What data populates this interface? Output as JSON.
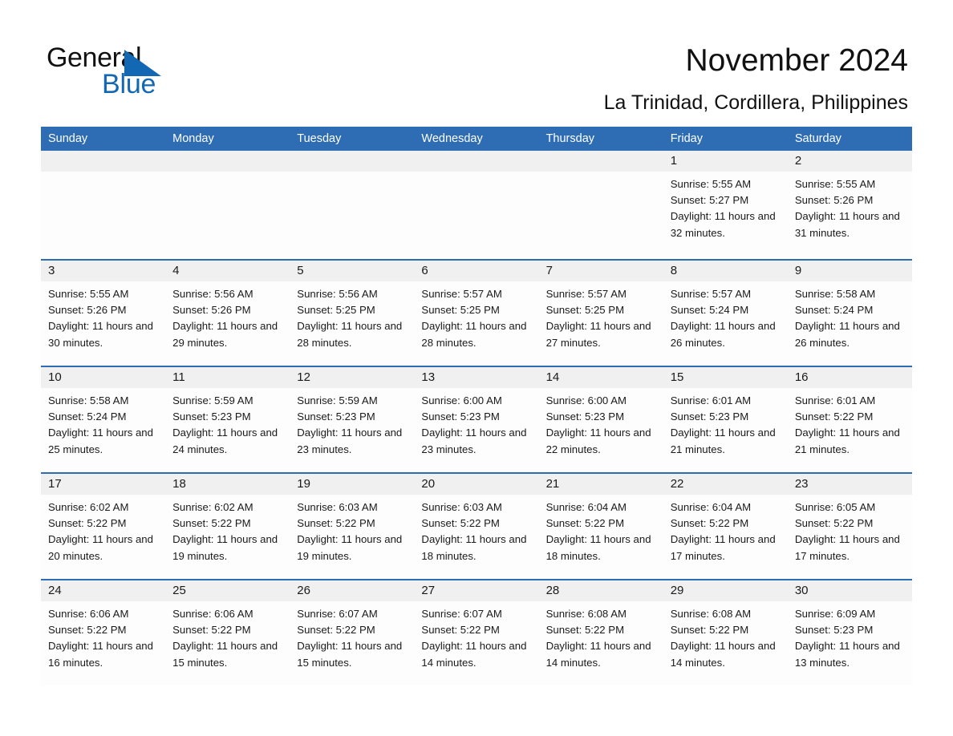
{
  "brand": {
    "name_part1": "General",
    "name_part2": "Blue",
    "logo_icon": "triangle-flag-icon",
    "accent_color": "#1268b3"
  },
  "header": {
    "title": "November 2024",
    "location": "La Trinidad, Cordillera, Philippines"
  },
  "theme": {
    "header_row_bg": "#2e6db4",
    "row_divider": "#2e6db4",
    "daynum_bg": "#f0f0f0",
    "cell_bg": "#fdfdfd"
  },
  "calendar": {
    "weekdays": [
      "Sunday",
      "Monday",
      "Tuesday",
      "Wednesday",
      "Thursday",
      "Friday",
      "Saturday"
    ],
    "weeks": [
      [
        {
          "day": "",
          "empty": true
        },
        {
          "day": "",
          "empty": true
        },
        {
          "day": "",
          "empty": true
        },
        {
          "day": "",
          "empty": true
        },
        {
          "day": "",
          "empty": true
        },
        {
          "day": "1",
          "sunrise": "Sunrise: 5:55 AM",
          "sunset": "Sunset: 5:27 PM",
          "daylight": "Daylight: 11 hours and 32 minutes."
        },
        {
          "day": "2",
          "sunrise": "Sunrise: 5:55 AM",
          "sunset": "Sunset: 5:26 PM",
          "daylight": "Daylight: 11 hours and 31 minutes."
        }
      ],
      [
        {
          "day": "3",
          "sunrise": "Sunrise: 5:55 AM",
          "sunset": "Sunset: 5:26 PM",
          "daylight": "Daylight: 11 hours and 30 minutes."
        },
        {
          "day": "4",
          "sunrise": "Sunrise: 5:56 AM",
          "sunset": "Sunset: 5:26 PM",
          "daylight": "Daylight: 11 hours and 29 minutes."
        },
        {
          "day": "5",
          "sunrise": "Sunrise: 5:56 AM",
          "sunset": "Sunset: 5:25 PM",
          "daylight": "Daylight: 11 hours and 28 minutes."
        },
        {
          "day": "6",
          "sunrise": "Sunrise: 5:57 AM",
          "sunset": "Sunset: 5:25 PM",
          "daylight": "Daylight: 11 hours and 28 minutes."
        },
        {
          "day": "7",
          "sunrise": "Sunrise: 5:57 AM",
          "sunset": "Sunset: 5:25 PM",
          "daylight": "Daylight: 11 hours and 27 minutes."
        },
        {
          "day": "8",
          "sunrise": "Sunrise: 5:57 AM",
          "sunset": "Sunset: 5:24 PM",
          "daylight": "Daylight: 11 hours and 26 minutes."
        },
        {
          "day": "9",
          "sunrise": "Sunrise: 5:58 AM",
          "sunset": "Sunset: 5:24 PM",
          "daylight": "Daylight: 11 hours and 26 minutes."
        }
      ],
      [
        {
          "day": "10",
          "sunrise": "Sunrise: 5:58 AM",
          "sunset": "Sunset: 5:24 PM",
          "daylight": "Daylight: 11 hours and 25 minutes."
        },
        {
          "day": "11",
          "sunrise": "Sunrise: 5:59 AM",
          "sunset": "Sunset: 5:23 PM",
          "daylight": "Daylight: 11 hours and 24 minutes."
        },
        {
          "day": "12",
          "sunrise": "Sunrise: 5:59 AM",
          "sunset": "Sunset: 5:23 PM",
          "daylight": "Daylight: 11 hours and 23 minutes."
        },
        {
          "day": "13",
          "sunrise": "Sunrise: 6:00 AM",
          "sunset": "Sunset: 5:23 PM",
          "daylight": "Daylight: 11 hours and 23 minutes."
        },
        {
          "day": "14",
          "sunrise": "Sunrise: 6:00 AM",
          "sunset": "Sunset: 5:23 PM",
          "daylight": "Daylight: 11 hours and 22 minutes."
        },
        {
          "day": "15",
          "sunrise": "Sunrise: 6:01 AM",
          "sunset": "Sunset: 5:23 PM",
          "daylight": "Daylight: 11 hours and 21 minutes."
        },
        {
          "day": "16",
          "sunrise": "Sunrise: 6:01 AM",
          "sunset": "Sunset: 5:22 PM",
          "daylight": "Daylight: 11 hours and 21 minutes."
        }
      ],
      [
        {
          "day": "17",
          "sunrise": "Sunrise: 6:02 AM",
          "sunset": "Sunset: 5:22 PM",
          "daylight": "Daylight: 11 hours and 20 minutes."
        },
        {
          "day": "18",
          "sunrise": "Sunrise: 6:02 AM",
          "sunset": "Sunset: 5:22 PM",
          "daylight": "Daylight: 11 hours and 19 minutes."
        },
        {
          "day": "19",
          "sunrise": "Sunrise: 6:03 AM",
          "sunset": "Sunset: 5:22 PM",
          "daylight": "Daylight: 11 hours and 19 minutes."
        },
        {
          "day": "20",
          "sunrise": "Sunrise: 6:03 AM",
          "sunset": "Sunset: 5:22 PM",
          "daylight": "Daylight: 11 hours and 18 minutes."
        },
        {
          "day": "21",
          "sunrise": "Sunrise: 6:04 AM",
          "sunset": "Sunset: 5:22 PM",
          "daylight": "Daylight: 11 hours and 18 minutes."
        },
        {
          "day": "22",
          "sunrise": "Sunrise: 6:04 AM",
          "sunset": "Sunset: 5:22 PM",
          "daylight": "Daylight: 11 hours and 17 minutes."
        },
        {
          "day": "23",
          "sunrise": "Sunrise: 6:05 AM",
          "sunset": "Sunset: 5:22 PM",
          "daylight": "Daylight: 11 hours and 17 minutes."
        }
      ],
      [
        {
          "day": "24",
          "sunrise": "Sunrise: 6:06 AM",
          "sunset": "Sunset: 5:22 PM",
          "daylight": "Daylight: 11 hours and 16 minutes."
        },
        {
          "day": "25",
          "sunrise": "Sunrise: 6:06 AM",
          "sunset": "Sunset: 5:22 PM",
          "daylight": "Daylight: 11 hours and 15 minutes."
        },
        {
          "day": "26",
          "sunrise": "Sunrise: 6:07 AM",
          "sunset": "Sunset: 5:22 PM",
          "daylight": "Daylight: 11 hours and 15 minutes."
        },
        {
          "day": "27",
          "sunrise": "Sunrise: 6:07 AM",
          "sunset": "Sunset: 5:22 PM",
          "daylight": "Daylight: 11 hours and 14 minutes."
        },
        {
          "day": "28",
          "sunrise": "Sunrise: 6:08 AM",
          "sunset": "Sunset: 5:22 PM",
          "daylight": "Daylight: 11 hours and 14 minutes."
        },
        {
          "day": "29",
          "sunrise": "Sunrise: 6:08 AM",
          "sunset": "Sunset: 5:22 PM",
          "daylight": "Daylight: 11 hours and 14 minutes."
        },
        {
          "day": "30",
          "sunrise": "Sunrise: 6:09 AM",
          "sunset": "Sunset: 5:23 PM",
          "daylight": "Daylight: 11 hours and 13 minutes."
        }
      ]
    ]
  }
}
